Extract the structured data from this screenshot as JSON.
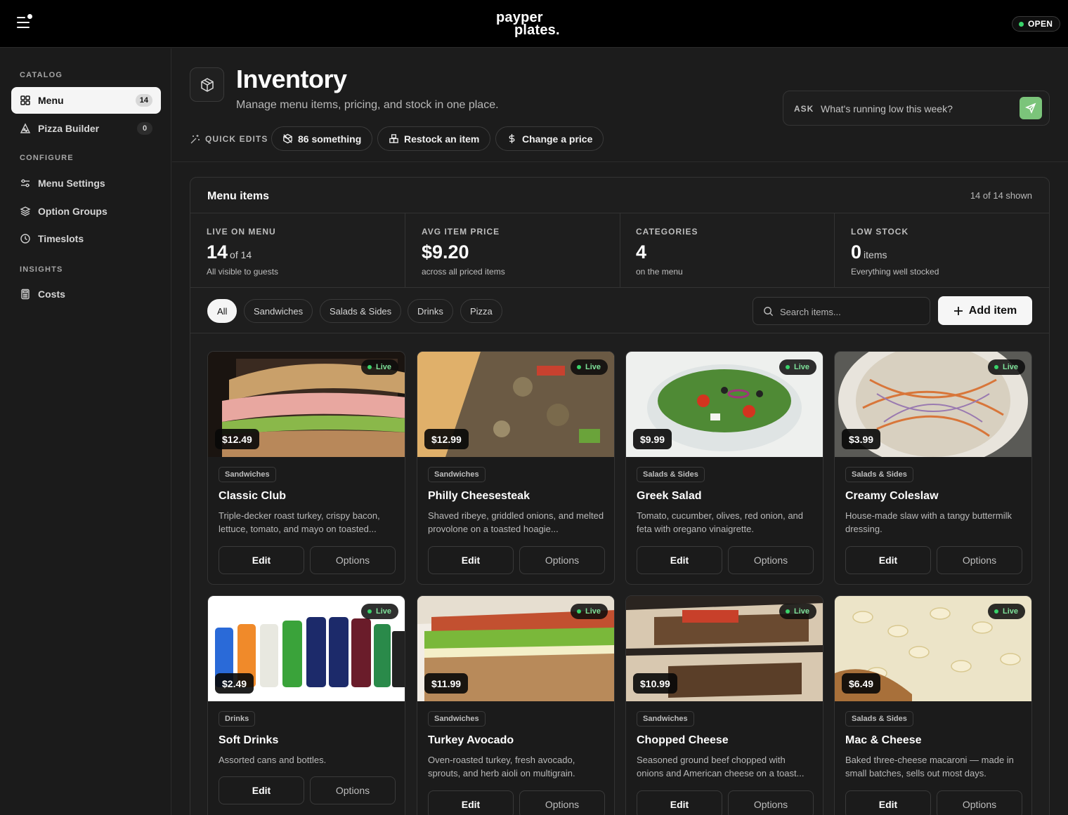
{
  "app": {
    "logo_line1": "payper",
    "logo_line2": "plates.",
    "status": "OPEN"
  },
  "sidebar": {
    "sections": {
      "catalog": "CATALOG",
      "configure": "CONFIGURE",
      "insights": "INSIGHTS"
    },
    "items": {
      "menu": {
        "label": "Menu",
        "count": "14",
        "icon": "grid-icon"
      },
      "pizza_builder": {
        "label": "Pizza Builder",
        "count": "0",
        "icon": "pizza-icon"
      },
      "menu_settings": {
        "label": "Menu Settings",
        "icon": "sliders-icon"
      },
      "option_groups": {
        "label": "Option Groups",
        "icon": "layers-icon"
      },
      "timeslots": {
        "label": "Timeslots",
        "icon": "clock-icon"
      },
      "costs": {
        "label": "Costs",
        "icon": "calculator-icon"
      }
    }
  },
  "header": {
    "title": "Inventory",
    "subtitle": "Manage menu items, pricing, and stock in one place.",
    "ask_label": "ASK",
    "ask_placeholder": "What's running low this week?",
    "quick_edits_label": "QUICK EDITS",
    "quick_edits": {
      "eighty_six": "86 something",
      "restock": "Restock an item",
      "change_price": "Change a price"
    }
  },
  "panel": {
    "title": "Menu items",
    "shown": "14 of 14 shown",
    "stats": {
      "live": {
        "label": "LIVE ON MENU",
        "value": "14",
        "suffix": "of 14",
        "sub": "All visible to guests"
      },
      "avg": {
        "label": "AVG ITEM PRICE",
        "value": "$9.20",
        "sub": "across all priced items"
      },
      "categories": {
        "label": "CATEGORIES",
        "value": "4",
        "sub": "on the menu"
      },
      "low": {
        "label": "LOW STOCK",
        "value": "0",
        "suffix": "items",
        "sub": "Everything well stocked"
      }
    },
    "filters": {
      "all": "All",
      "sandwiches": "Sandwiches",
      "salads": "Salads & Sides",
      "drinks": "Drinks",
      "pizza": "Pizza"
    },
    "search_placeholder": "Search items...",
    "add_label": "Add item",
    "edit_label": "Edit",
    "options_label": "Options",
    "live_label": "Live"
  },
  "items": [
    {
      "name": "Classic Club",
      "price": "$12.49",
      "category": "Sandwiches",
      "desc": "Triple-decker roast turkey, crispy bacon, lettuce, tomato, and mayo on toasted..."
    },
    {
      "name": "Philly Cheesesteak",
      "price": "$12.99",
      "category": "Sandwiches",
      "desc": "Shaved ribeye, griddled onions, and melted provolone on a toasted hoagie..."
    },
    {
      "name": "Greek Salad",
      "price": "$9.99",
      "category": "Salads & Sides",
      "desc": "Tomato, cucumber, olives, red onion, and feta with oregano vinaigrette."
    },
    {
      "name": "Creamy Coleslaw",
      "price": "$3.99",
      "category": "Salads & Sides",
      "desc": "House-made slaw with a tangy buttermilk dressing."
    },
    {
      "name": "Soft Drinks",
      "price": "$2.49",
      "category": "Drinks",
      "desc": "Assorted cans and bottles."
    },
    {
      "name": "Turkey Avocado",
      "price": "$11.99",
      "category": "Sandwiches",
      "desc": "Oven-roasted turkey, fresh avocado, sprouts, and herb aioli on multigrain."
    },
    {
      "name": "Chopped Cheese",
      "price": "$10.99",
      "category": "Sandwiches",
      "desc": "Seasoned ground beef chopped with onions and American cheese on a toast..."
    },
    {
      "name": "Mac & Cheese",
      "price": "$6.49",
      "category": "Salads & Sides",
      "desc": "Baked three-cheese macaroni — made in small batches, sells out most days."
    }
  ]
}
